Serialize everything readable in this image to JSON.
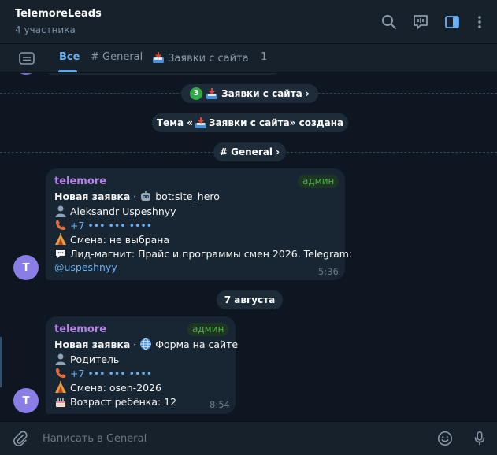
{
  "header": {
    "title": "TelemoreLeads",
    "subtitle": "4 участника"
  },
  "tabs": [
    {
      "label": "Все"
    },
    {
      "label": "# General"
    },
    {
      "label": "Заявки с сайта"
    },
    {
      "label": "1"
    }
  ],
  "service": {
    "topic_unread": "3",
    "topic_link": "Заявки с сайта ›",
    "topic_created_prefix": "Тема «",
    "topic_created_name": "Заявки с сайта",
    "topic_created_suffix": "» создана",
    "general_link": "# General ›",
    "date": "7 августа"
  },
  "messages": [
    {
      "sender": "telemore",
      "role": "админ",
      "title": "Новая заявка",
      "separator": " · ",
      "source": "bot:site_hero",
      "name": "Aleksandr Uspeshnyy",
      "phone": "+7 ••• ••• ••••",
      "shift": "Смена: не выбрана",
      "lead": "Лид-магнит: Прайс и программы смен 2026. Telegram:",
      "handle": "@uspeshnyy",
      "time": "5:36",
      "avatar": "T"
    },
    {
      "sender": "telemore",
      "role": "админ",
      "title": "Новая заявка",
      "separator": " · ",
      "source": "Форма на сайте",
      "name": "Родитель",
      "phone": "+7 ••• ••• ••••",
      "shift": "Смена: osen-2026",
      "age": "Возраст ребёнка: 12",
      "time": "8:54",
      "avatar": "T"
    }
  ],
  "input": {
    "placeholder": "Написать в General"
  },
  "colors": {
    "background": "#0e1621",
    "panel": "#17212b",
    "bubble": "#182533",
    "accent": "#6ab2f2",
    "sender": "#b383e5",
    "admin": "#4fae4e",
    "avatar": "#8b7de6"
  },
  "icons": [
    "search-icon",
    "live-stream-icon",
    "sidebar-toggle-icon",
    "more-vert-icon",
    "topics-list-icon",
    "inbox-tray-icon",
    "robot-icon",
    "globe-icon",
    "person-icon",
    "phone-icon",
    "tent-icon",
    "speech-bubble-icon",
    "cake-icon",
    "attach-icon",
    "emoji-icon",
    "microphone-icon"
  ]
}
